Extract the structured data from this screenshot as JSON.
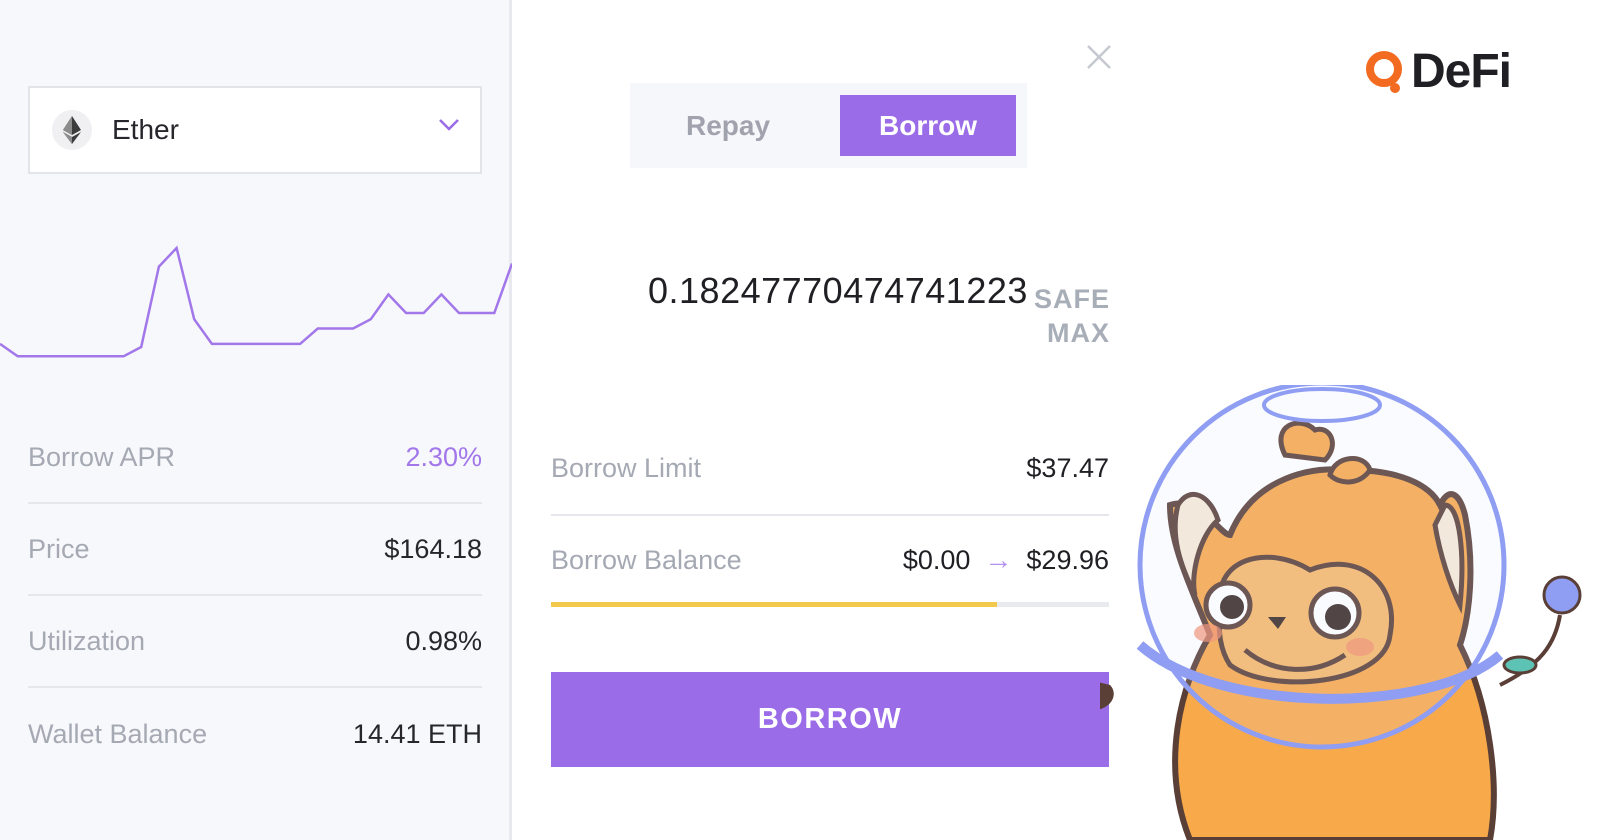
{
  "asset": {
    "name": "Ether",
    "icon": "ethereum-icon"
  },
  "chart_data": {
    "type": "line",
    "title": "",
    "series": [
      {
        "values": [
          22,
          18,
          18,
          18,
          18,
          18,
          18,
          18,
          21,
          47,
          53,
          30,
          22,
          22,
          22,
          22,
          22,
          22,
          27,
          27,
          27,
          30,
          38,
          32,
          32,
          38,
          32,
          32,
          32,
          48
        ]
      }
    ],
    "color": "#a277ea"
  },
  "stats": [
    {
      "label": "Borrow APR",
      "value": "2.30%",
      "accent": true
    },
    {
      "label": "Price",
      "value": "$164.18",
      "accent": false
    },
    {
      "label": "Utilization",
      "value": "0.98%",
      "accent": false
    },
    {
      "label": "Wallet Balance",
      "value": "14.41 ETH",
      "accent": false
    }
  ],
  "tabs": {
    "repay": "Repay",
    "borrow": "Borrow",
    "active": "borrow"
  },
  "amount": "0.18247770474741223",
  "safe_max": {
    "line1": "SAFE",
    "line2": "MAX"
  },
  "borrow_limit": {
    "label": "Borrow Limit",
    "value": "$37.47"
  },
  "borrow_balance": {
    "label": "Borrow Balance",
    "from": "$0.00",
    "arrow": "→",
    "to": "$29.96"
  },
  "progress": {
    "fraction": 0.8,
    "color": "#f2c94c"
  },
  "action_button": "BORROW",
  "logo": {
    "text": "DeFi",
    "accent": "#f26b21"
  },
  "colors": {
    "accent": "#9a6ce8",
    "muted": "#a5a9b3"
  }
}
